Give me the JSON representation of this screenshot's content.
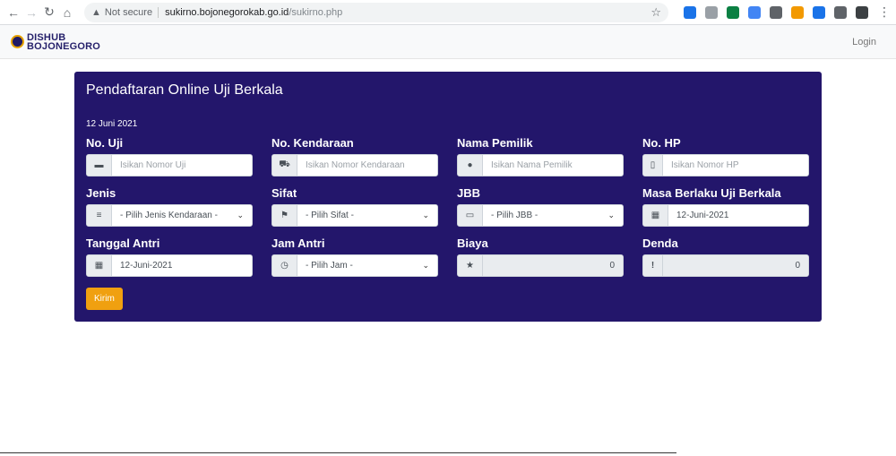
{
  "browser": {
    "security_label": "Not secure",
    "url_host": "sukirno.bojonegorokab.go.id",
    "url_path": "/sukirno.php",
    "extension_colors": [
      "#1a73e8",
      "#9aa0a6",
      "#0b8043",
      "#4285f4",
      "#5f6368",
      "#f29900",
      "#1a73e8",
      "#5f6368",
      "#3c4043"
    ]
  },
  "site": {
    "logo_line1": "DISHUB",
    "logo_line2": "BOJONEGORO",
    "login_label": "Login"
  },
  "form": {
    "title": "Pendaftaran Online Uji Berkala",
    "date": "12 Juni 2021",
    "fields": {
      "no_uji": {
        "label": "No. Uji",
        "placeholder": "Isikan Nomor Uji",
        "icon": "truck-icon"
      },
      "no_kendaraan": {
        "label": "No. Kendaraan",
        "placeholder": "Isikan Nomor Kendaraan",
        "icon": "car-icon"
      },
      "nama_pemilik": {
        "label": "Nama Pemilik",
        "placeholder": "Isikan Nama Pemilik",
        "icon": "user-icon"
      },
      "no_hp": {
        "label": "No. HP",
        "placeholder": "Isikan Nomor HP",
        "icon": "mobile-icon"
      },
      "jenis": {
        "label": "Jenis",
        "value": "- Pilih Jenis Kendaraan -",
        "icon": "list-icon"
      },
      "sifat": {
        "label": "Sifat",
        "value": "- Pilih Sifat -",
        "icon": "flag-icon"
      },
      "jbb": {
        "label": "JBB",
        "value": "- Pilih JBB -",
        "icon": "inbox-icon"
      },
      "masa_berlaku": {
        "label": "Masa Berlaku Uji Berkala",
        "value": "12-Juni-2021",
        "icon": "calendar-icon"
      },
      "tanggal_antri": {
        "label": "Tanggal Antri",
        "value": "12-Juni-2021",
        "icon": "calendar-icon"
      },
      "jam_antri": {
        "label": "Jam Antri",
        "value": "- Pilih Jam -",
        "icon": "clock-icon"
      },
      "biaya": {
        "label": "Biaya",
        "value": "0",
        "icon": "star-icon"
      },
      "denda": {
        "label": "Denda",
        "value": "0",
        "icon": "exclamation-icon"
      }
    },
    "submit_label": "Kirim"
  }
}
